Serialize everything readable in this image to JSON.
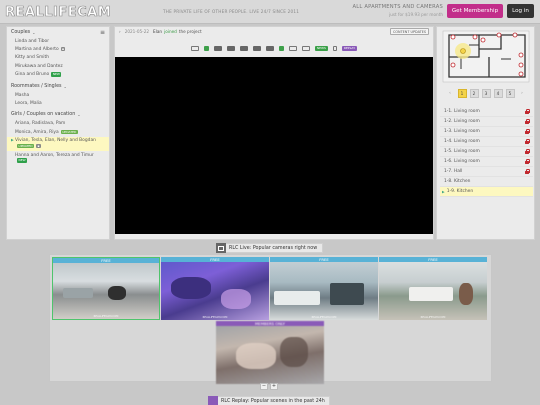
{
  "header": {
    "logo": "REALLIFECAM",
    "tagline": "THE PRIVATE LIFE OF OTHER PEOPLE. LIVE 24/7 SINCE 2011",
    "apartments_title": "ALL APARTMENTS AND CAMERAS",
    "apartments_price": "just for $19.93 per month",
    "membership_label": "Get Membership",
    "login_label": "Log in"
  },
  "sidebar": {
    "sections": [
      {
        "title": "Couples",
        "items": [
          {
            "label": "Linda and Tibor"
          },
          {
            "label": "Martina and Alberto",
            "badge": "gray"
          },
          {
            "label": "Kitty and Smith"
          },
          {
            "label": "Mirukawa and Dantez"
          },
          {
            "label": "Gina and Bruno",
            "badge": "NEW"
          }
        ]
      },
      {
        "title": "Roommates / Singles",
        "items": [
          {
            "label": "Masha"
          },
          {
            "label": "Leora, Malia"
          }
        ]
      },
      {
        "title": "Girls / Couples on vacation",
        "items": [
          {
            "label": "Ariana, Radislava, Pam"
          },
          {
            "label": "Monica, Amira, Riya",
            "badge": "UPDATED"
          },
          {
            "label": "Vivian, Tesla, Elan, Nelly and Bogdan",
            "badge": "UPDATED",
            "badge2": "gray",
            "active": true
          },
          {
            "label": "Hanna and Aaron, Tereza and Timur",
            "badge": "NEW"
          }
        ]
      }
    ]
  },
  "event": {
    "date": "2021-05-22",
    "name": "Elan",
    "action": "joined",
    "object": "the project",
    "updates_label": "CONTENT UPDATES"
  },
  "toolbar": {
    "news_label": "NEWS",
    "replay_label": "REPLAY"
  },
  "pager": {
    "pages": [
      "1",
      "2",
      "3",
      "4",
      "5"
    ],
    "active_page": "1",
    "prev": "‹",
    "next": "›"
  },
  "cameras": [
    {
      "label": "1-1. Living room",
      "locked": true
    },
    {
      "label": "1-2. Living room",
      "locked": true
    },
    {
      "label": "1-3. Living room",
      "locked": true
    },
    {
      "label": "1-4. Living room",
      "locked": true
    },
    {
      "label": "1-5. Living room",
      "locked": true
    },
    {
      "label": "1-6. Living room",
      "locked": true
    },
    {
      "label": "1-7. Hall",
      "locked": true
    },
    {
      "label": "1-8. Kitchen",
      "locked": false
    },
    {
      "label": "1-9. Kitchen",
      "locked": false,
      "active": true
    }
  ],
  "popular": {
    "title": "RLC Live: Popular cameras right now",
    "thumbs": [
      {
        "label": "FREE"
      },
      {
        "label": "FREE"
      },
      {
        "label": "FREE"
      },
      {
        "label": "FREE"
      },
      {
        "label": "MEMBERS ONLY"
      }
    ],
    "watermark": "REALLIFECAM.COM",
    "zoom_out": "−",
    "zoom_in": "+"
  },
  "replay": {
    "title": "RLC Replay: Popular scenes in the past 24h"
  },
  "colors": {
    "membership": "#c22e8a",
    "free_label": "#58b2d6",
    "members_label": "#8a5ab8",
    "lock": "#c0272d",
    "active_row": "#fdf8c0",
    "active_page": "#f3d34a"
  }
}
